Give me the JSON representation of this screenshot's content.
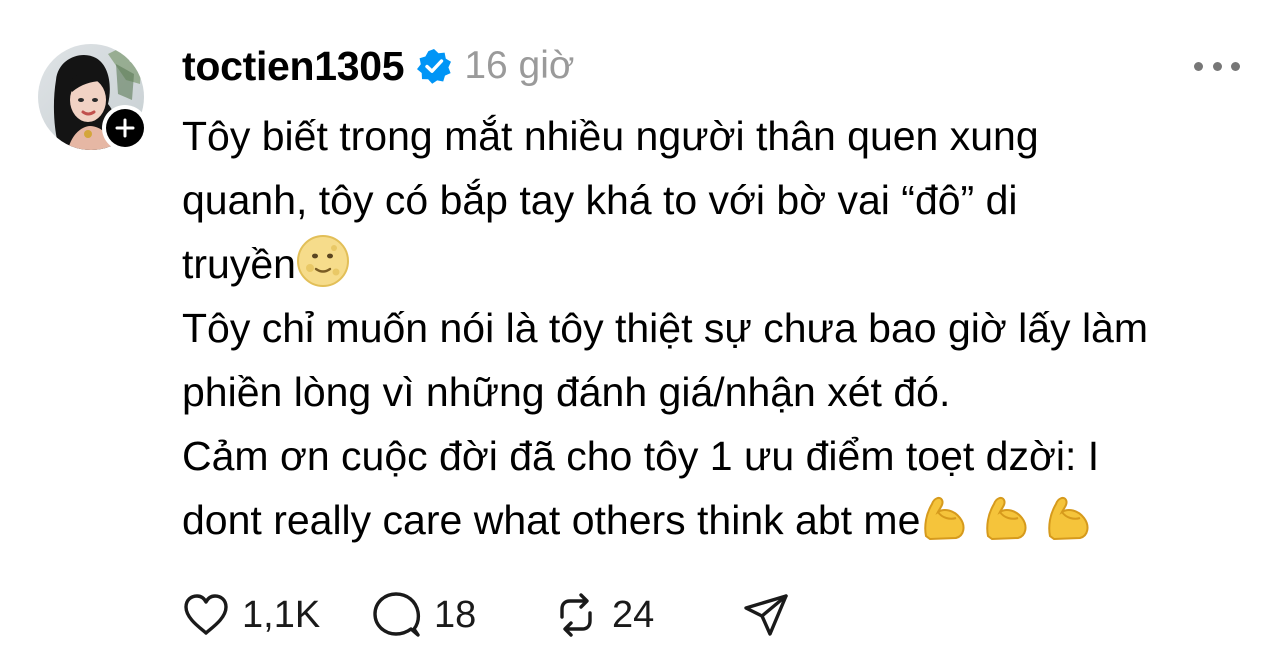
{
  "post": {
    "author": {
      "username": "toctien1305",
      "verified": true,
      "avatar_icon": "profile-photo",
      "follow_icon": "plus-icon"
    },
    "time": "16 giờ",
    "more_icon": "ellipsis-icon",
    "paragraphs": [
      {
        "lines": [
          "Tôy biết trong mắt nhiều người thân quen xung",
          "quanh, tôy có bắp tay khá to với bờ vai “đô” di",
          "truyền"
        ],
        "trailing_emoji": "full-moon-face"
      },
      {
        "lines": [
          "Tôy chỉ muốn nói là tôy thiệt sự chưa bao giờ lấy làm",
          "phiền lòng vì những đánh giá/nhận xét đó."
        ]
      },
      {
        "lines": [
          "Cảm ơn cuộc đời đã cho tôy 1 ưu điểm toẹt dzời: I",
          "dont really care what others think abt me"
        ],
        "trailing_emoji": "flexed-biceps x3"
      }
    ],
    "actions": {
      "like": {
        "icon": "heart-icon",
        "count": "1,1K"
      },
      "comment": {
        "icon": "comment-icon",
        "count": "18"
      },
      "repost": {
        "icon": "repost-icon",
        "count": "24"
      },
      "share": {
        "icon": "send-icon"
      }
    },
    "colors": {
      "text": "#000000",
      "muted": "#9a9a9a",
      "verified_badge": "#0095f6"
    }
  }
}
